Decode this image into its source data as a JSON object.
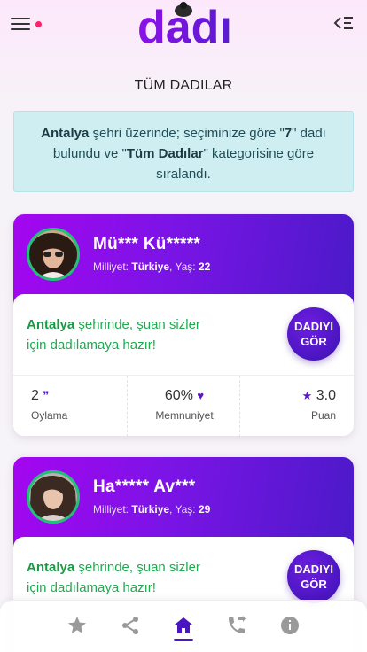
{
  "header": {
    "logo_text": "dadı",
    "icons": {
      "menu": "hamburger-menu-icon",
      "filter": "filter-list-icon"
    },
    "notification_color": "#ff1f6b"
  },
  "page_title": "TÜM DADILAR",
  "info": {
    "city": "Antalya",
    "text_1": " şehri üzerinde; seçiminize göre \"",
    "count": "7",
    "text_2": "\" dadı bulundu ve \"",
    "category": "Tüm Dadılar",
    "text_3": "\" kategorisine göre sıralandı."
  },
  "cards": [
    {
      "name": "Mü*** Kü*****",
      "nationality_label": "Milliyet:",
      "nationality": "Türkiye",
      "age_label": "Yaş:",
      "age": "22",
      "ready_city": "Antalya",
      "ready_text": " şehrinde, şuan sizler için dadılamaya hazır!",
      "button_line1": "DADIYI",
      "button_line2": "GÖR",
      "votes": "2",
      "votes_label": "Oylama",
      "satisfaction": "60%",
      "satisfaction_label": "Memnuniyet",
      "rating": "3.0",
      "rating_label": "Puan"
    },
    {
      "name": "Ha***** Av***",
      "nationality_label": "Milliyet:",
      "nationality": "Türkiye",
      "age_label": "Yaş:",
      "age": "29",
      "ready_city": "Antalya",
      "ready_text": " şehrinde, şuan sizler için dadılamaya hazır!",
      "button_line1": "DADIYI",
      "button_line2": "GÖR"
    }
  ],
  "bottom_nav": {
    "items": [
      "star-icon",
      "share-icon",
      "home-icon",
      "phone-transfer-icon",
      "info-icon"
    ],
    "active": "home-icon"
  },
  "colors": {
    "accent": "#4a15c0",
    "gradient_start": "#a406f0",
    "green": "#1faa4f",
    "info_bg": "#cfeef1"
  }
}
